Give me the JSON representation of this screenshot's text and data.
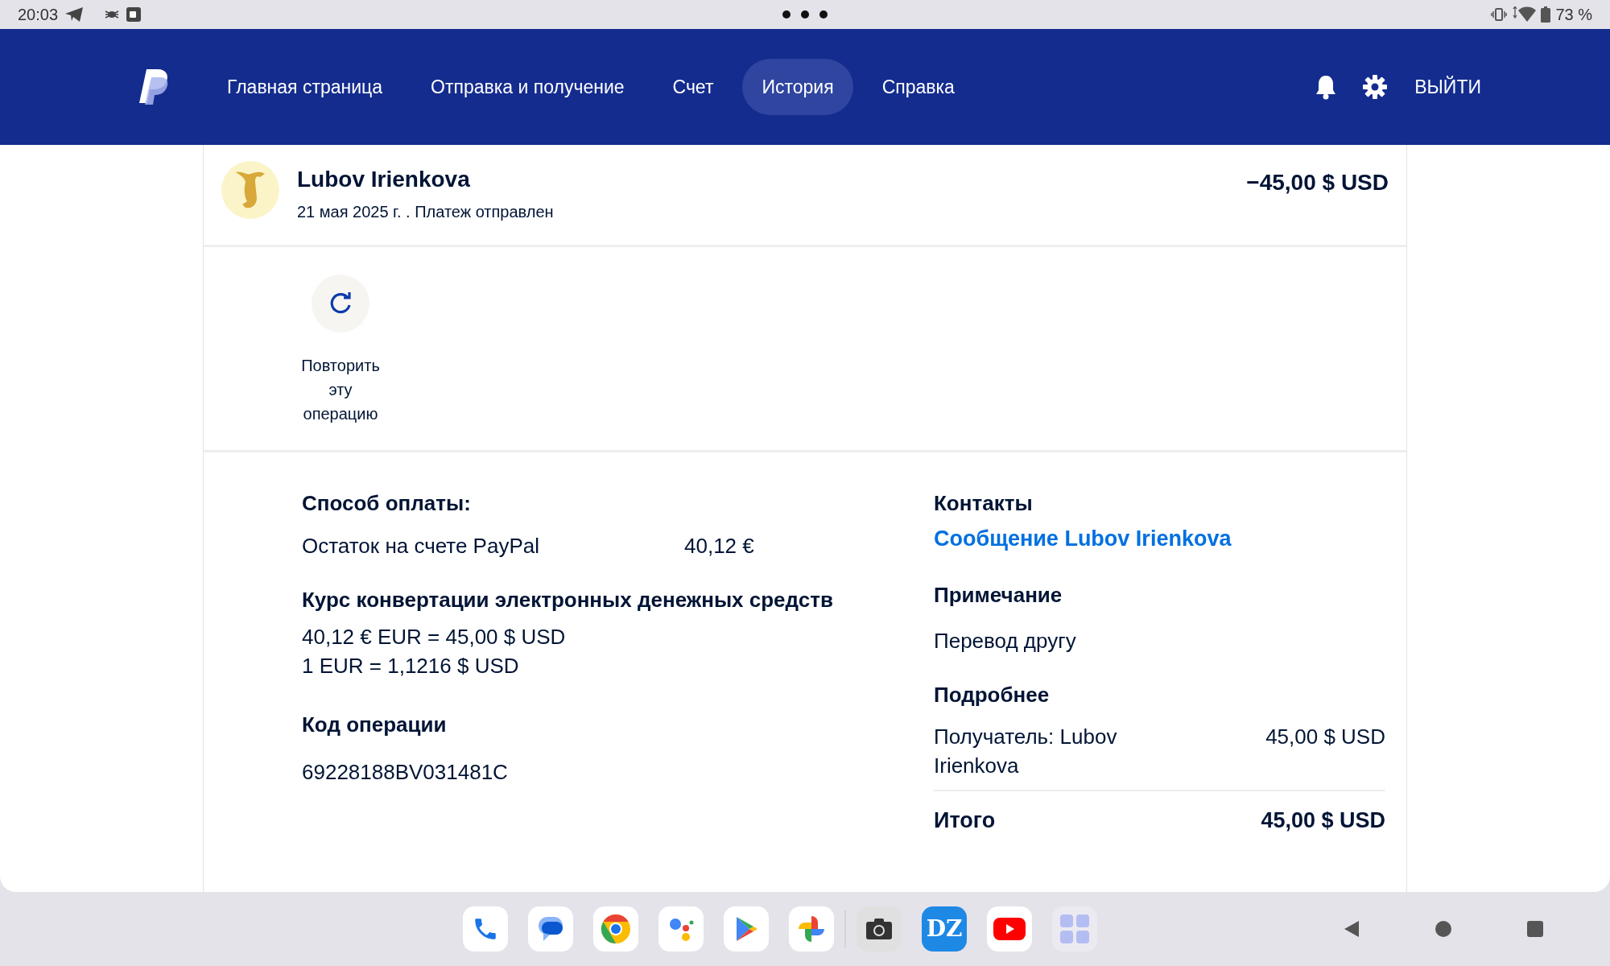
{
  "status_bar": {
    "time": "20:03",
    "battery": "73 %"
  },
  "nav": {
    "items": [
      {
        "label": "Главная страница",
        "selected": false
      },
      {
        "label": "Отправка и получение",
        "selected": false
      },
      {
        "label": "Счет",
        "selected": false
      },
      {
        "label": "История",
        "selected": true
      },
      {
        "label": "Справка",
        "selected": false
      }
    ],
    "logout": "ВЫЙТИ"
  },
  "transaction": {
    "name": "Lubov Irienkova",
    "subtitle": "21 мая 2025 г. . Платеж отправлен",
    "amount": "−45,00 $ USD"
  },
  "repeat_action": {
    "label": "Повторить эту операцию"
  },
  "payment": {
    "title": "Способ оплаты:",
    "source": "Остаток на счете PayPal",
    "source_amount": "40,12 €"
  },
  "conversion": {
    "title": "Курс конвертации электронных денежных средств",
    "lines": [
      "40,12 € EUR = 45,00 $ USD",
      "1 EUR = 1,1216 $ USD"
    ]
  },
  "operation_code": {
    "title": "Код операции",
    "value": "69228188BV031481C"
  },
  "contacts": {
    "title": "Контакты",
    "link": "Сообщение Lubov Irienkova"
  },
  "note": {
    "title": "Примечание",
    "text": "Перевод другу"
  },
  "details": {
    "title": "Подробнее",
    "rows": [
      {
        "label": "Получатель: Lubov Irienkova",
        "value": "45,00 $ USD"
      }
    ],
    "total_label": "Итого",
    "total_value": "45,00 $ USD"
  },
  "dock": [
    {
      "kind": "phone"
    },
    {
      "kind": "messages"
    },
    {
      "kind": "browser"
    },
    {
      "kind": "assistant"
    },
    {
      "kind": "store"
    },
    {
      "kind": "photos"
    },
    {
      "kind": "camera"
    },
    {
      "kind": "dz",
      "label": "DZ"
    },
    {
      "kind": "video"
    },
    {
      "kind": "apps"
    }
  ]
}
